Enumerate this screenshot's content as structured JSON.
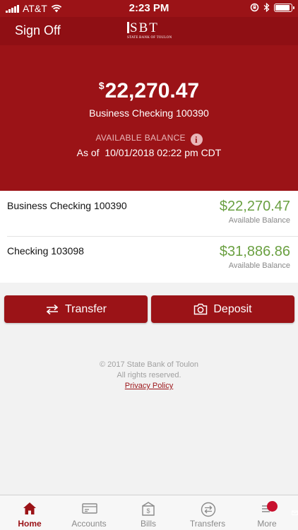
{
  "status_bar": {
    "carrier": "AT&T",
    "time": "2:23 PM",
    "battery_level": 0.9
  },
  "nav": {
    "sign_off_label": "Sign Off",
    "logo_text": "SBT",
    "logo_subtext": "STATE BANK OF TOULON"
  },
  "summary": {
    "currency_symbol": "$",
    "amount": "22,270.47",
    "account_name": "Business Checking 100390",
    "available_label": "AVAILABLE BALANCE",
    "as_of_label": "As of",
    "as_of_value": "10/01/2018 02:22 pm CDT"
  },
  "accounts": [
    {
      "name": "Business Checking 100390",
      "amount": "$22,270.47",
      "sub": "Available Balance"
    },
    {
      "name": "Checking 103098",
      "amount": "$31,886.86",
      "sub": "Available Balance"
    }
  ],
  "actions": {
    "transfer_label": "Transfer",
    "deposit_label": "Deposit"
  },
  "footer": {
    "copyright": "© 2017 State Bank of Toulon",
    "rights": "All rights reserved.",
    "privacy_label": "Privacy Policy"
  },
  "tabs": [
    {
      "label": "Home",
      "icon": "home-icon",
      "active": true
    },
    {
      "label": "Accounts",
      "icon": "accounts-icon",
      "active": false
    },
    {
      "label": "Bills",
      "icon": "bills-icon",
      "active": false
    },
    {
      "label": "Transfers",
      "icon": "transfers-icon",
      "active": false
    },
    {
      "label": "More",
      "icon": "more-icon",
      "active": false
    }
  ],
  "colors": {
    "brand": "#9b1317",
    "positive": "#6aa041",
    "muted": "#8a8a8a"
  }
}
